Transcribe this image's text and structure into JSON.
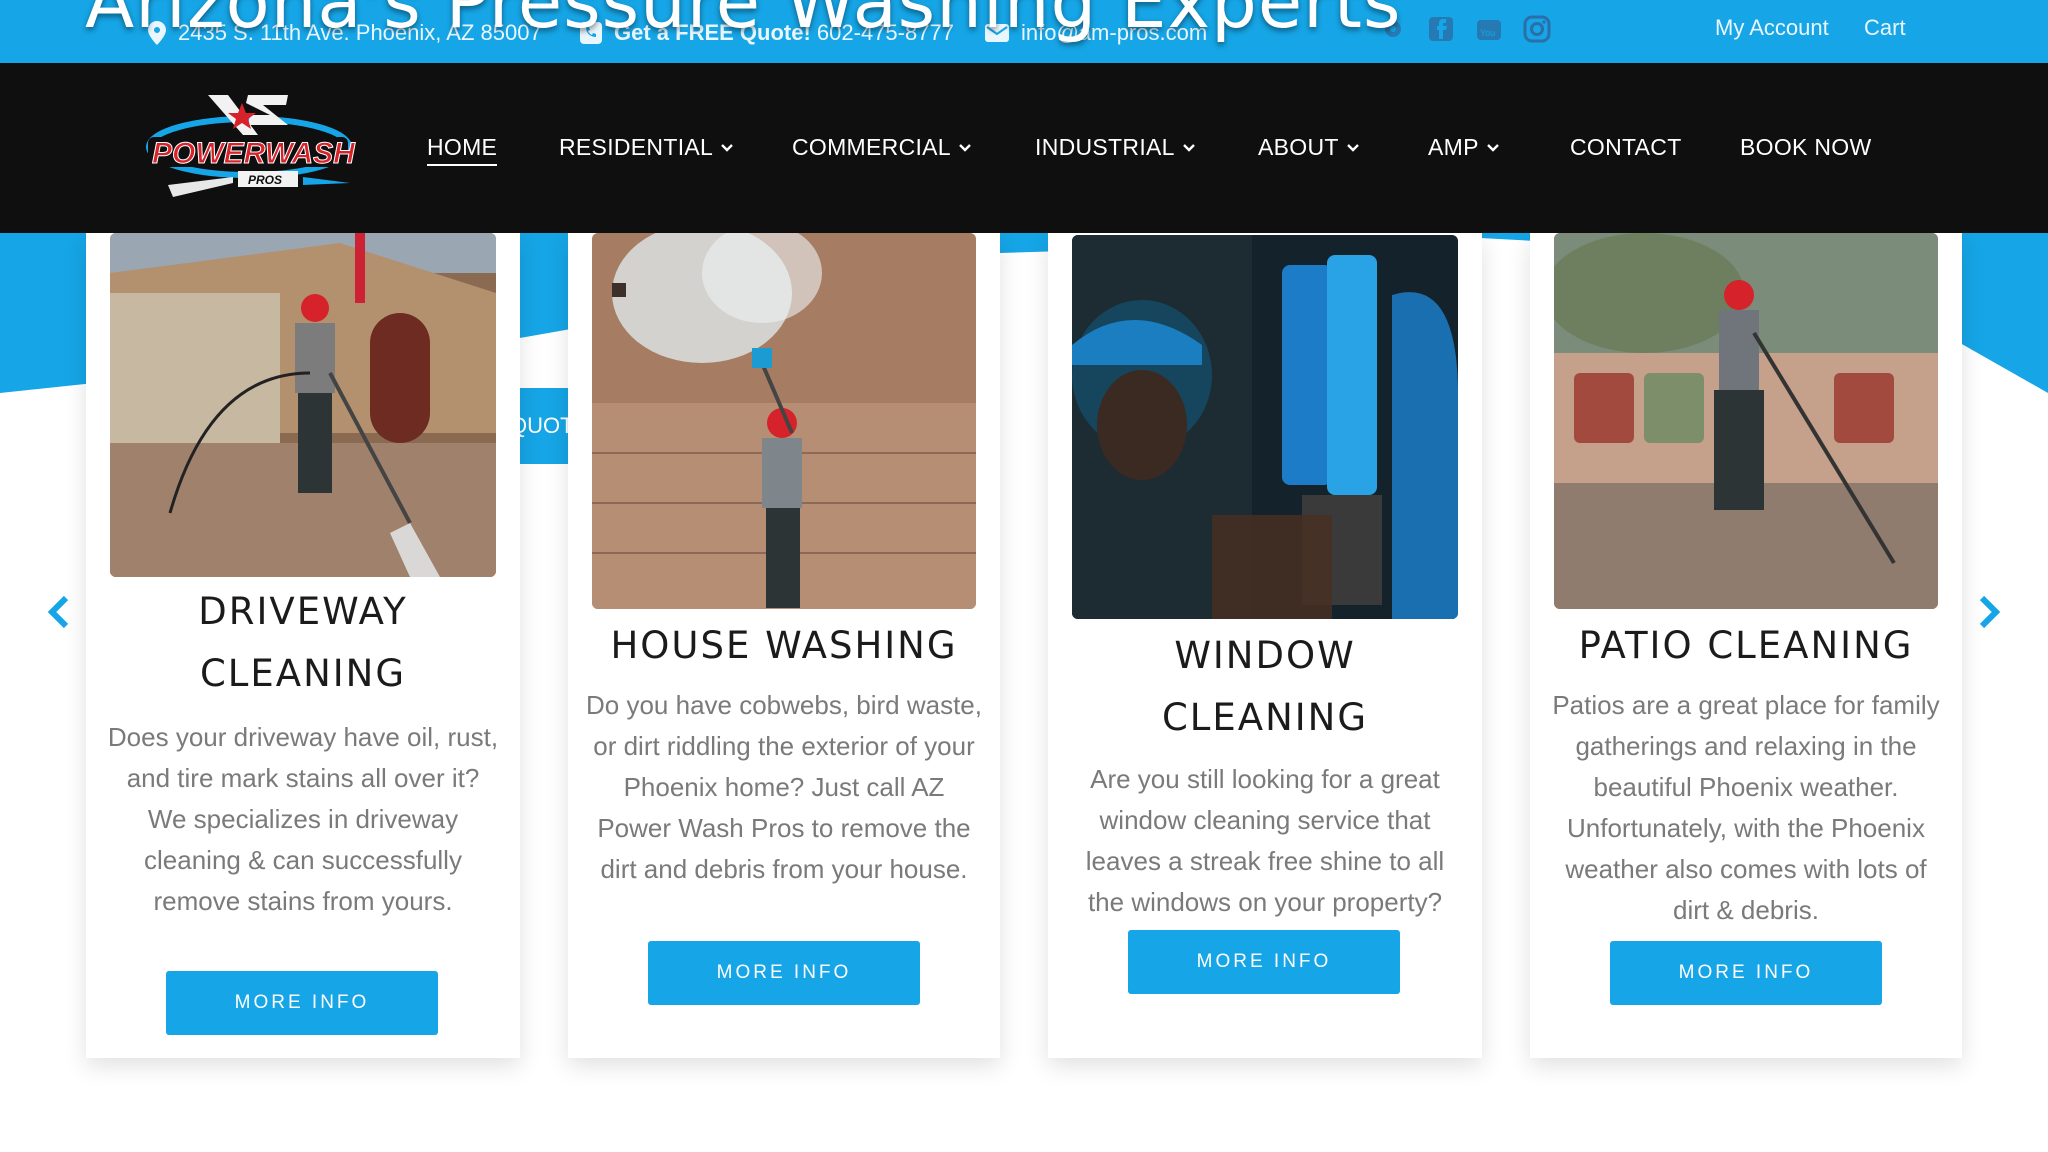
{
  "topbar": {
    "hero_title": "Arizona's Pressure Washing Experts",
    "address": "2435 S. 11th Ave. Phoenix, AZ 85007",
    "quote_bold": "Get a FREE Quote!",
    "phone": "602-475-8777",
    "email": "info@am-pros.com",
    "social_icons": [
      "yelp-icon",
      "facebook-icon",
      "youtube-icon",
      "instagram-icon"
    ],
    "my_account": "My Account",
    "cart": "Cart"
  },
  "nav": {
    "logo_alt": "AZ PowerWash Pros",
    "items": [
      {
        "label": "HOME",
        "active": true,
        "dropdown": false
      },
      {
        "label": "RESIDENTIAL",
        "dropdown": true
      },
      {
        "label": "COMMERCIAL",
        "dropdown": true
      },
      {
        "label": "INDUSTRIAL",
        "dropdown": true
      },
      {
        "label": "ABOUT",
        "dropdown": true
      },
      {
        "label": "AMP",
        "dropdown": true
      },
      {
        "label": "CONTACT",
        "dropdown": false
      },
      {
        "label": "BOOK NOW",
        "dropdown": false
      }
    ]
  },
  "quote_tab": "QUOTE!",
  "cards": [
    {
      "title_line1": "DRIVEWAY",
      "title_line2": "CLEANING",
      "description": "Does your driveway have oil, rust, and tire mark stains all over it? We specializes in driveway cleaning & can successfully remove stains from yours.",
      "button": "MORE INFO"
    },
    {
      "title_line1": "HOUSE WASHING",
      "description": "Do you have cobwebs, bird waste, or dirt riddling the exterior of your Phoenix home? Just call AZ Power Wash Pros to remove the dirt and debris from your house.",
      "button": "MORE INFO"
    },
    {
      "title_line1": "WINDOW",
      "title_line2": "CLEANING",
      "description": "Are you still looking for a great window cleaning service that leaves a streak free shine to all the windows on your property?",
      "button": "MORE INFO"
    },
    {
      "title_line1": "PATIO CLEANING",
      "description": "Patios are a great place for family gatherings and relaxing in the beautiful Phoenix weather. Unfortunately, with the Phoenix weather also comes with lots of dirt & debris.",
      "button": "MORE INFO"
    }
  ],
  "colors": {
    "brand_blue": "#16a5e6",
    "nav_black": "#0f0f0f",
    "text_gray": "#7a7a7a"
  },
  "carousel": {
    "prev_icon": "chevron-left-icon",
    "next_icon": "chevron-right-icon"
  }
}
